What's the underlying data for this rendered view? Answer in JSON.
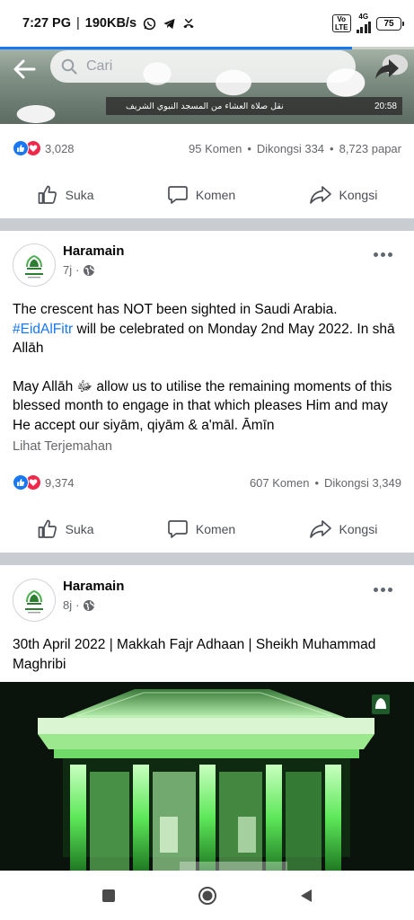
{
  "status_bar": {
    "time": "7:27 PG",
    "speed": "190KB/s",
    "volte": "Vo LTE",
    "network": "4G",
    "battery": "75"
  },
  "top_video": {
    "search_placeholder": "Cari",
    "caption_arabic": "نقل صلاة العشاء من المسجد النبوي الشريف",
    "timestamp": "20:58",
    "progress": 0.85
  },
  "post1_stats": {
    "reaction_count": "3,028",
    "comments": "95 Komen",
    "shares": "Dikongsi 334",
    "views": "8,723 papar"
  },
  "actions": {
    "like": "Suka",
    "comment": "Komen",
    "share": "Kongsi"
  },
  "post2": {
    "page_name": "Haramain",
    "time": "7j",
    "line1": "The crescent has NOT been sighted in Saudi Arabia.",
    "hashtag": "#EidAlFitr",
    "line2": " will be celebrated on Monday 2nd May 2022. In shā Allāh",
    "paragraph2": "May Allāh ﷻ allow us to utilise the remaining moments of this blessed month to engage in that which pleases Him and may He accept our siyām, qiyām & a'māl. Āmīn",
    "translate": "Lihat Terjemahan",
    "reaction_count": "9,374",
    "comments": "607 Komen",
    "shares": "Dikongsi 3,349"
  },
  "post3": {
    "page_name": "Haramain",
    "time": "8j",
    "text": "30th April 2022 | Makkah Fajr Adhaan | Sheikh Muhammad Maghribi"
  },
  "colors": {
    "accent": "#1877f2",
    "love": "#f0284a",
    "muted": "#65676b",
    "divider": "#c9ccd1"
  },
  "icons": [
    "back-arrow-icon",
    "search-icon",
    "share-arrow-icon",
    "like-icon",
    "comment-icon",
    "share-icon",
    "globe-icon",
    "more-icon",
    "recent-apps-icon",
    "home-icon",
    "back-icon"
  ]
}
